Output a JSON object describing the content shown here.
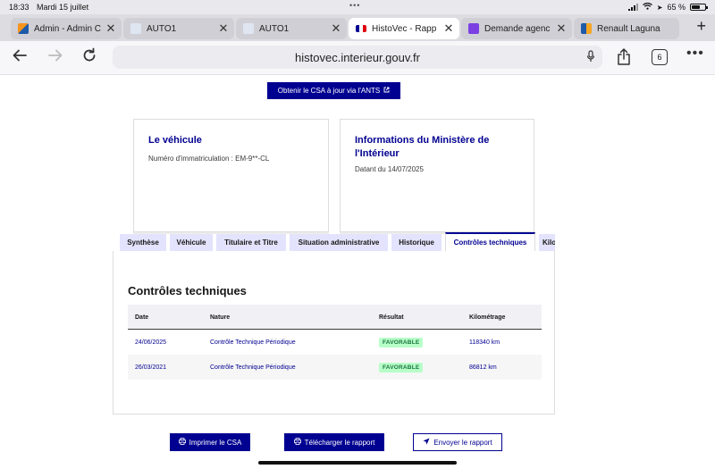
{
  "status_bar": {
    "time": "18:33",
    "date": "Mardi 15 juillet",
    "battery": "65 %"
  },
  "browser": {
    "tabs": [
      {
        "title": "Admin - Admin C",
        "favicon_color": "#f7941d",
        "active": false
      },
      {
        "title": "AUTO1",
        "favicon_color": "#3b5998",
        "active": false
      },
      {
        "title": "AUTO1",
        "favicon_color": "#3b5998",
        "active": false
      },
      {
        "title": "HistoVec - Rapp",
        "favicon_color": "#000091",
        "active": true
      },
      {
        "title": "Demande agenc",
        "favicon_color": "#7b3fe4",
        "active": false
      },
      {
        "title": "Renault Laguna",
        "favicon_color": "#f5a623",
        "active": false
      }
    ],
    "url": "histovec.interieur.gouv.fr",
    "tab_count": "6"
  },
  "page": {
    "ants_button": "Obtenir le CSA à jour via l'ANTS",
    "vehicle_card": {
      "title": "Le véhicule",
      "subtitle": "Numéro d'immatriculation : EM-9**-CL"
    },
    "ministry_card": {
      "title_line1": "Informations du Ministère de",
      "title_line2": "l'Intérieur",
      "subtitle": "Datant du 14/07/2025"
    },
    "report_tabs": [
      {
        "label": "Synthèse",
        "active": false
      },
      {
        "label": "Véhicule",
        "active": false
      },
      {
        "label": "Titulaire et Titre",
        "active": false
      },
      {
        "label": "Situation administrative",
        "active": false
      },
      {
        "label": "Historique",
        "active": false
      },
      {
        "label": "Contrôles techniques",
        "active": true
      },
      {
        "label": "Kilo",
        "active": false
      }
    ],
    "section_title": "Contrôles techniques",
    "table": {
      "headers": [
        "Date",
        "Nature",
        "Résultat",
        "Kilométrage"
      ],
      "rows": [
        {
          "date": "24/06/2025",
          "nature": "Contrôle Technique Périodique",
          "result": "FAVORABLE",
          "km": "118340 km"
        },
        {
          "date": "26/03/2021",
          "nature": "Contrôle Technique Périodique",
          "result": "FAVORABLE",
          "km": "86812 km"
        }
      ]
    },
    "actions": {
      "print": "Imprimer le CSA",
      "download": "Télécharger le rapport",
      "send": "Envoyer le rapport"
    }
  },
  "colors": {
    "primary": "#000091",
    "badge_bg": "#b8fec9",
    "badge_text": "#18753c"
  }
}
